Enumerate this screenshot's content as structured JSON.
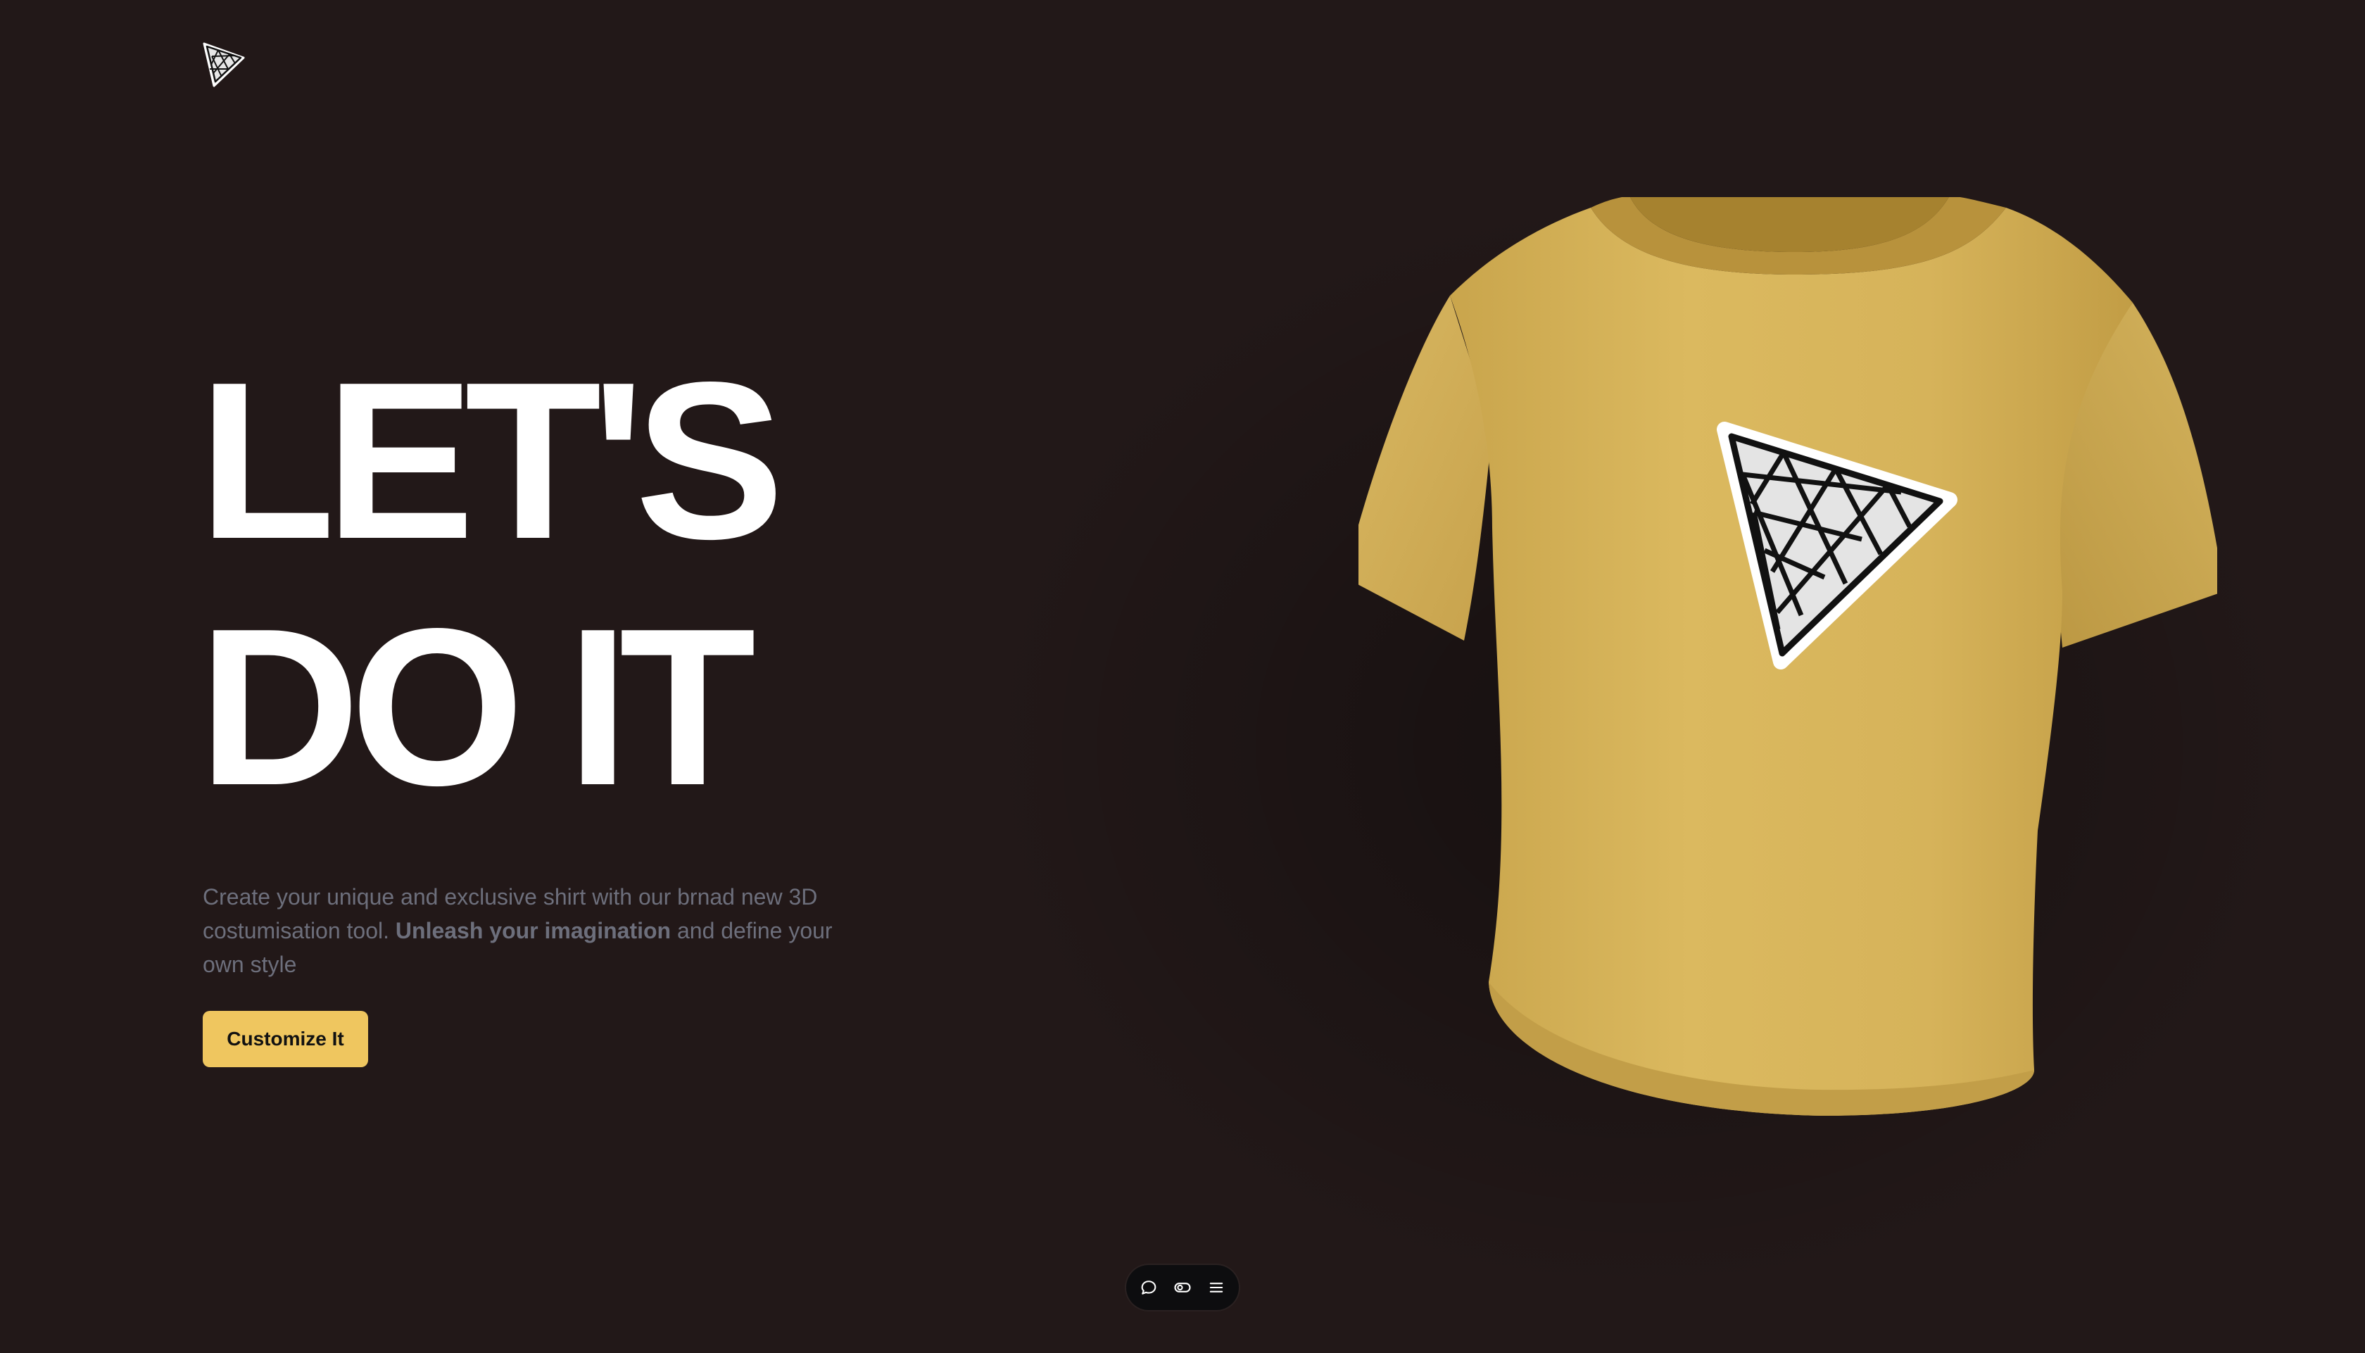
{
  "brand": {
    "logo_icon": "triangle-mesh-logo-icon"
  },
  "hero": {
    "headline_line1": "LET'S",
    "headline_line2": "DO IT",
    "description_part1": "Create your unique and exclusive shirt with our brnad new 3D costumisation tool.",
    "description_bold": "Unleash your imagination",
    "description_part2": "and define your own style",
    "cta_label": "Customize It"
  },
  "colors": {
    "background": "#221818",
    "accent": "#efc65f",
    "shirt": "#d9b75f",
    "text_primary": "#ffffff",
    "text_muted": "#6d6f7c"
  },
  "toolbar": {
    "icons": [
      "chat-bubble-icon",
      "toggle-icon",
      "menu-icon"
    ]
  }
}
